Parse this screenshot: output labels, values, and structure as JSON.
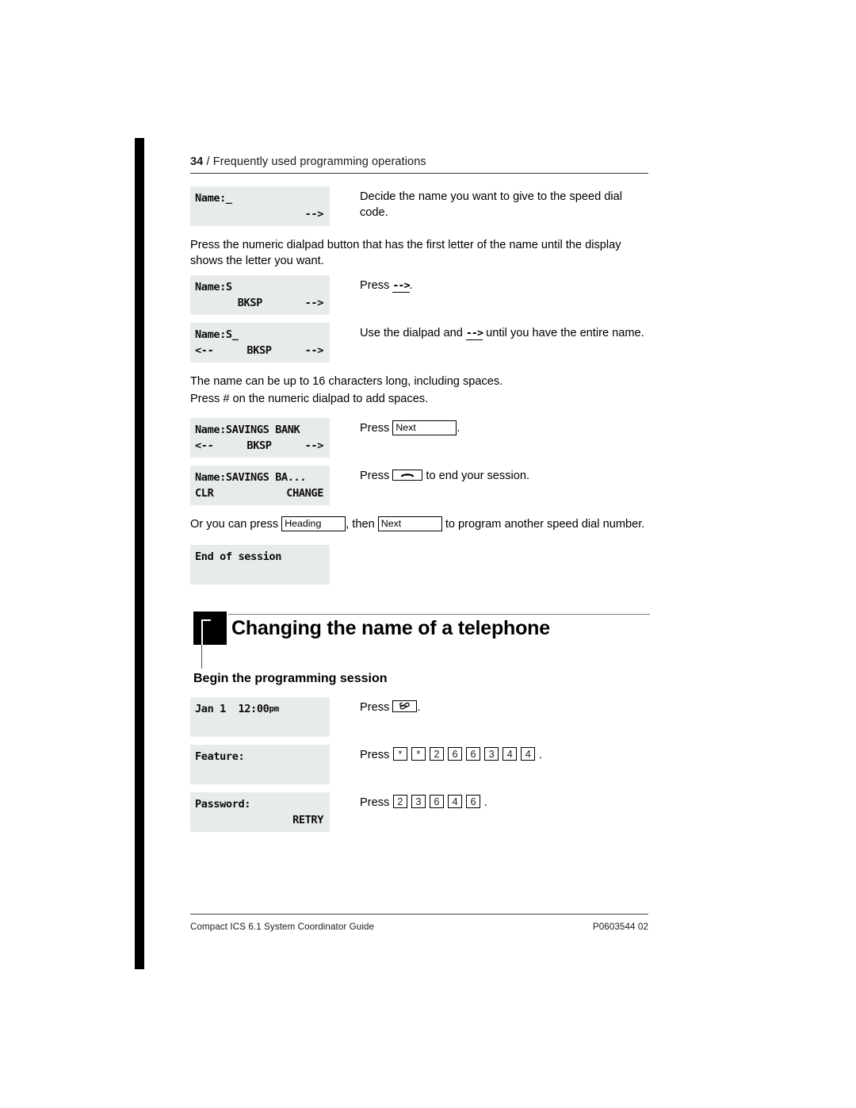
{
  "page": {
    "folio": "34",
    "running_head": "/ Frequently used programming operations"
  },
  "steps_speed_dial": [
    {
      "lcd": {
        "line1_left": "Name:_",
        "line1_right": "",
        "line2_left": "",
        "line2_center": "",
        "line2_right": "-->"
      },
      "instruction": "Decide the name you want to give to the speed dial code."
    },
    {
      "lcd": {
        "line1_left": "Name:S",
        "line1_right": "",
        "line2_left": "",
        "line2_center": "BKSP",
        "line2_right": "-->"
      },
      "instruction_prefix": "Press ",
      "instruction_token": "-->",
      "instruction_suffix": "."
    },
    {
      "lcd": {
        "line1_left": "Name:S_",
        "line1_right": "",
        "line2_left": "<--",
        "line2_center": "BKSP",
        "line2_right": "-->"
      },
      "instruction_prefix": "Use the dialpad and ",
      "instruction_token": "-->",
      "instruction_suffix": " until you have the entire name."
    },
    {
      "lcd": {
        "line1_left": "Name:SAVINGS BANK",
        "line1_right": "",
        "line2_left": "<--",
        "line2_center": "BKSP",
        "line2_right": "-->"
      },
      "instruction_prefix": "Press ",
      "instruction_key": "Next",
      "instruction_suffix": "."
    },
    {
      "lcd": {
        "line1_left": "Name:SAVINGS BA...",
        "line1_right": "",
        "line2_left": "CLR",
        "line2_center": "",
        "line2_right": "CHANGE"
      },
      "instruction_prefix": "Press ",
      "instruction_key_icon": "release-handset-key",
      "instruction_suffix": " to end your session."
    },
    {
      "lcd": {
        "line1_left": "End of session",
        "line1_right": "",
        "line2_left": "",
        "line2_center": "",
        "line2_right": ""
      },
      "instruction": ""
    }
  ],
  "paragraphs": {
    "dialpad_first_letter": "Press the numeric dialpad button that has the first letter of the name until the display shows the letter you want.",
    "name_length_line1": "The name can be up to 16 characters long, including spaces.",
    "name_length_line2": "Press # on the numeric dialpad to add spaces.",
    "another_speed_dial_a": "Or you can press ",
    "another_speed_dial_key1": "Heading",
    "another_speed_dial_b": ", then ",
    "another_speed_dial_key2": "Next",
    "another_speed_dial_c": " to program another speed dial number."
  },
  "section": {
    "title": "Changing the name of a telephone",
    "subhead": "Begin the programming session"
  },
  "steps_begin_session": [
    {
      "lcd": {
        "line1_left": "Jan 1  12:00",
        "line1_small": "pm",
        "line2_left": "",
        "line2_right": ""
      },
      "instruction_prefix": "Press ",
      "instruction_key_icon": "feature-key",
      "instruction_suffix": "."
    },
    {
      "lcd": {
        "line1_left": "Feature:",
        "line2_left": "",
        "line2_right": ""
      },
      "instruction_prefix": "Press ",
      "instruction_keys": [
        "*",
        "*",
        "2",
        "6",
        "6",
        "3",
        "4",
        "4"
      ],
      "instruction_suffix": "."
    },
    {
      "lcd": {
        "line1_left": "Password:",
        "line2_left": "",
        "line2_right": "RETRY"
      },
      "instruction_prefix": "Press ",
      "instruction_keys": [
        "2",
        "3",
        "6",
        "4",
        "6"
      ],
      "instruction_suffix": "."
    }
  ],
  "footer": {
    "left": "Compact ICS 6.1 System Coordinator Guide",
    "right": "P0603544  02"
  },
  "colors": {
    "lcd_background": "#e8ebeb",
    "ink": "#000000",
    "rule": "#3a3a3a"
  }
}
